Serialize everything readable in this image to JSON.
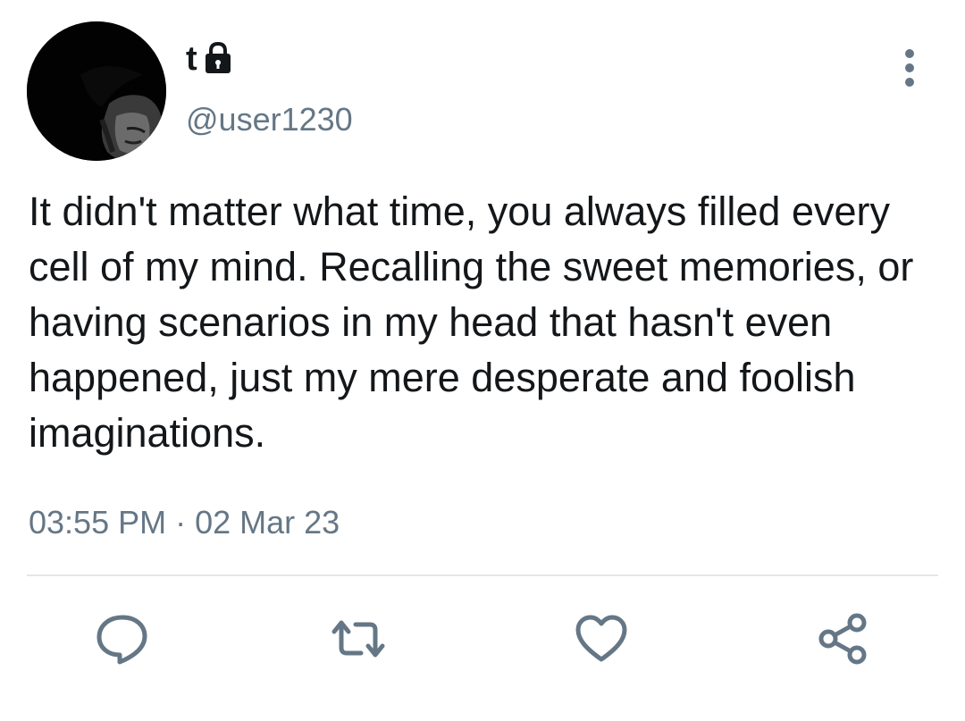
{
  "user": {
    "display_name": "t",
    "handle": "@user1230",
    "protected": true,
    "avatar": "profile-photo"
  },
  "tweet": {
    "text": "It didn't matter what time, you always filled every cell of my mind. Recalling the sweet memories, or having scenarios in my head that hasn't even happened, just my mere desperate and foolish imaginations.",
    "timestamp": "03:55 PM · 02 Mar 23"
  },
  "actions": [
    {
      "name": "reply",
      "icon": "speech-bubble-icon"
    },
    {
      "name": "retweet",
      "icon": "retweet-arrows-icon"
    },
    {
      "name": "like",
      "icon": "heart-icon"
    },
    {
      "name": "share",
      "icon": "share-nodes-icon"
    }
  ],
  "menu": {
    "icon": "vertical-ellipsis-icon"
  },
  "colors": {
    "text": "#14171a",
    "secondary": "#657786",
    "icon": "#657786",
    "divider": "#e1e8ed",
    "background": "#ffffff"
  }
}
